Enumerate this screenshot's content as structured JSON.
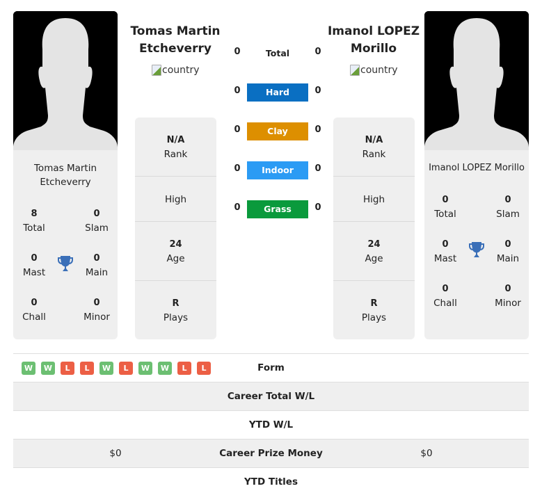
{
  "player1": {
    "name": "Tomas Martin Etcheverry",
    "heading_line1": "Tomas Martin",
    "heading_line2": "Etcheverry",
    "card_name_line1": "Tomas Martin",
    "card_name_line2": "Etcheverry",
    "country_alt": "country",
    "titles": {
      "total": {
        "value": "8",
        "label": "Total"
      },
      "slam": {
        "value": "0",
        "label": "Slam"
      },
      "mast": {
        "value": "0",
        "label": "Mast"
      },
      "main": {
        "value": "0",
        "label": "Main"
      },
      "chall": {
        "value": "0",
        "label": "Chall"
      },
      "minor": {
        "value": "0",
        "label": "Minor"
      }
    },
    "info": {
      "rank": {
        "value": "N/A",
        "label": "Rank"
      },
      "high": {
        "value": "",
        "label": "High"
      },
      "age": {
        "value": "24",
        "label": "Age"
      },
      "plays": {
        "value": "R",
        "label": "Plays"
      }
    },
    "prize_money": "$0"
  },
  "player2": {
    "name": "Imanol LOPEZ Morillo",
    "heading_line1": "Imanol LOPEZ",
    "heading_line2": "Morillo",
    "card_name_line1": "Imanol LOPEZ Morillo",
    "country_alt": "country",
    "titles": {
      "total": {
        "value": "0",
        "label": "Total"
      },
      "slam": {
        "value": "0",
        "label": "Slam"
      },
      "mast": {
        "value": "0",
        "label": "Mast"
      },
      "main": {
        "value": "0",
        "label": "Main"
      },
      "chall": {
        "value": "0",
        "label": "Chall"
      },
      "minor": {
        "value": "0",
        "label": "Minor"
      }
    },
    "info": {
      "rank": {
        "value": "N/A",
        "label": "Rank"
      },
      "high": {
        "value": "",
        "label": "High"
      },
      "age": {
        "value": "24",
        "label": "Age"
      },
      "plays": {
        "value": "R",
        "label": "Plays"
      }
    },
    "prize_money": "$0"
  },
  "h2h": [
    {
      "surface": "Total",
      "p1": "0",
      "p2": "0",
      "color": ""
    },
    {
      "surface": "Hard",
      "p1": "0",
      "p2": "0",
      "color": "#0a6fc2"
    },
    {
      "surface": "Clay",
      "p1": "0",
      "p2": "0",
      "color": "#dd8f00"
    },
    {
      "surface": "Indoor",
      "p1": "0",
      "p2": "0",
      "color": "#2b9bf4"
    },
    {
      "surface": "Grass",
      "p1": "0",
      "p2": "0",
      "color": "#0a9a3c"
    }
  ],
  "form": {
    "label": "Form",
    "results": [
      "W",
      "W",
      "L",
      "L",
      "W",
      "L",
      "W",
      "W",
      "L",
      "L"
    ],
    "colors": {
      "W": "#6cbf72",
      "L": "#ec5f45"
    }
  },
  "stats_rows": [
    {
      "label": "Career Total W/L",
      "p1": "",
      "p2": ""
    },
    {
      "label": "YTD W/L",
      "p1": "",
      "p2": ""
    },
    {
      "label": "Career Prize Money",
      "p1": "$0",
      "p2": "$0"
    },
    {
      "label": "YTD Titles",
      "p1": "",
      "p2": ""
    }
  ],
  "colors": {
    "trophy": "#3a6fb8",
    "card_bg": "#efefef"
  }
}
